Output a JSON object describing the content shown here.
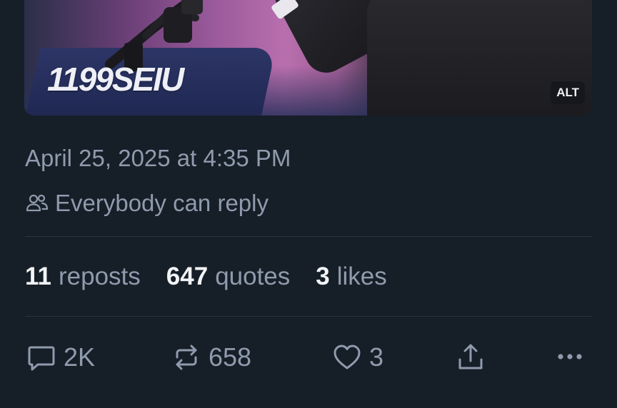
{
  "media": {
    "brand_text": "1199SEIU",
    "alt_label": "ALT"
  },
  "post": {
    "timestamp": "April 25, 2025 at 4:35 PM",
    "reply_setting": "Everybody can reply"
  },
  "stats": [
    {
      "value": "11",
      "label": "reposts"
    },
    {
      "value": "647",
      "label": "quotes"
    },
    {
      "value": "3",
      "label": "likes"
    }
  ],
  "actions": {
    "reply": {
      "icon": "reply-icon",
      "count": "2K"
    },
    "repost": {
      "icon": "repost-icon",
      "count": "658"
    },
    "like": {
      "icon": "heart-icon",
      "count": "3"
    },
    "share": {
      "icon": "share-icon"
    },
    "more": {
      "icon": "more-icon"
    }
  },
  "colors": {
    "background": "#161e27",
    "muted_text": "#8f9bad",
    "primary_text": "#f1f3f5",
    "divider": "#2a3541"
  }
}
